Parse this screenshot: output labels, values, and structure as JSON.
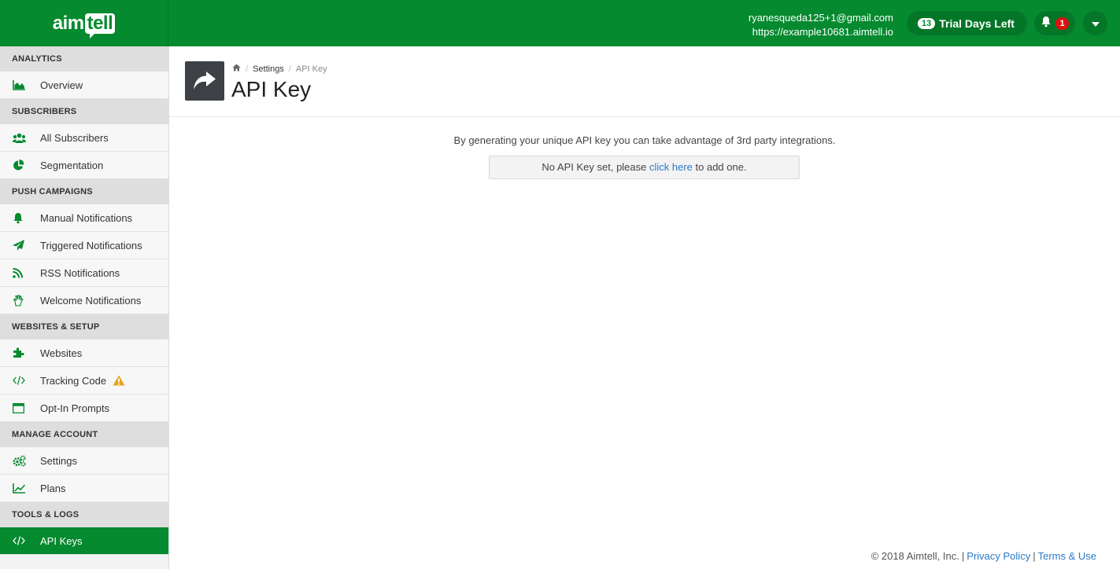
{
  "app": {
    "logo_text_main": "aim",
    "logo_text_bubble": "tell"
  },
  "topbar": {
    "email": "ryanesqueda125+1@gmail.com",
    "site_url": "https://example10681.aimtell.io",
    "trial_days": "13",
    "trial_label": "Trial Days Left",
    "notification_count": "1"
  },
  "sidebar": {
    "sections": [
      {
        "title": "ANALYTICS",
        "items": [
          {
            "label": "Overview",
            "icon": "area-chart-icon"
          }
        ]
      },
      {
        "title": "SUBSCRIBERS",
        "items": [
          {
            "label": "All Subscribers",
            "icon": "users-icon"
          },
          {
            "label": "Segmentation",
            "icon": "pie-chart-icon"
          }
        ]
      },
      {
        "title": "PUSH CAMPAIGNS",
        "items": [
          {
            "label": "Manual Notifications",
            "icon": "bell-icon"
          },
          {
            "label": "Triggered Notifications",
            "icon": "paper-plane-icon"
          },
          {
            "label": "RSS Notifications",
            "icon": "rss-icon"
          },
          {
            "label": "Welcome Notifications",
            "icon": "wave-hand-icon"
          }
        ]
      },
      {
        "title": "WEBSITES & SETUP",
        "items": [
          {
            "label": "Websites",
            "icon": "puzzle-icon"
          },
          {
            "label": "Tracking Code",
            "icon": "code-icon",
            "warning": true
          },
          {
            "label": "Opt-In Prompts",
            "icon": "window-icon"
          }
        ]
      },
      {
        "title": "MANAGE ACCOUNT",
        "items": [
          {
            "label": "Settings",
            "icon": "cogs-icon"
          },
          {
            "label": "Plans",
            "icon": "line-chart-icon"
          }
        ]
      },
      {
        "title": "TOOLS & LOGS",
        "items": [
          {
            "label": "API Keys",
            "icon": "code-icon",
            "active": true
          }
        ]
      }
    ]
  },
  "breadcrumb": {
    "parent": "Settings",
    "current": "API Key"
  },
  "page": {
    "title": "API Key",
    "intro": "By generating your unique API key you can take advantage of 3rd party integrations.",
    "notice_before": "No API Key set, please ",
    "notice_link": "click here",
    "notice_after": " to add one."
  },
  "footer": {
    "copyright": "© 2018 Aimtell, Inc.",
    "privacy": "Privacy Policy",
    "terms": "Terms & Use"
  },
  "colors": {
    "brand_green": "#058a2f",
    "link_blue": "#2a7ac6",
    "badge_red": "#e00f0f",
    "warning_orange": "#e8a317"
  }
}
